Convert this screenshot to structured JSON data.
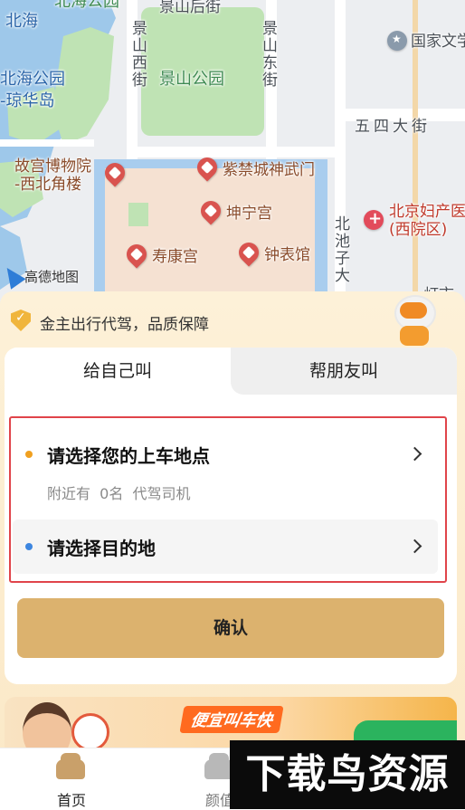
{
  "map": {
    "labels": {
      "beihai_top": "北海公园",
      "beihai": "北海",
      "jingshan_back_street": "景山后街",
      "jingshan_west_street": "景山西街",
      "jingshan_park": "景山公园",
      "jingshan_east_street": "景山东街",
      "national_art": "国家文学",
      "beihai_park_island": "北海公园\n-琼华岛",
      "wusi_street": "五四大街",
      "palace_museum_corner": "故宫博物院\n-西北角楼",
      "shenwu_gate": "紫禁城神武门",
      "kunning_palace": "坤宁宫",
      "beijing_hospital": "北京妇产医\n(西院区)",
      "beichizi": "北池子大",
      "shoukang_palace": "寿康宫",
      "clock_hall": "钟表馆",
      "dengshi": "灯市"
    },
    "logo_text": "高德地图",
    "colors": {
      "water": "#9ec8ea",
      "park": "#bfe3b4",
      "palace": "#f5e1d2",
      "road": "#ffffff",
      "moat": "#a9cdee"
    }
  },
  "banner": {
    "text": "金主出行代驾，品质保障",
    "icon": "shield-check-icon",
    "mascot": "astronaut-mascot"
  },
  "tabs": [
    {
      "label": "给自己叫",
      "active": true
    },
    {
      "label": "帮朋友叫",
      "active": false
    }
  ],
  "pickup": {
    "title": "请选择您的上车地点",
    "subtitle": "附近有  0名  代驾司机",
    "dot_color": "#f0a020"
  },
  "destination": {
    "title": "请选择目的地",
    "dot_color": "#3d86e0"
  },
  "confirm_label": "确认",
  "promo": {
    "badge": "便宜叫车快"
  },
  "nav": {
    "home": "首页",
    "second": "颜值"
  },
  "watermark": "下载鸟资源",
  "accent_color": "#dcb26e",
  "highlight_border": "#e0444a"
}
